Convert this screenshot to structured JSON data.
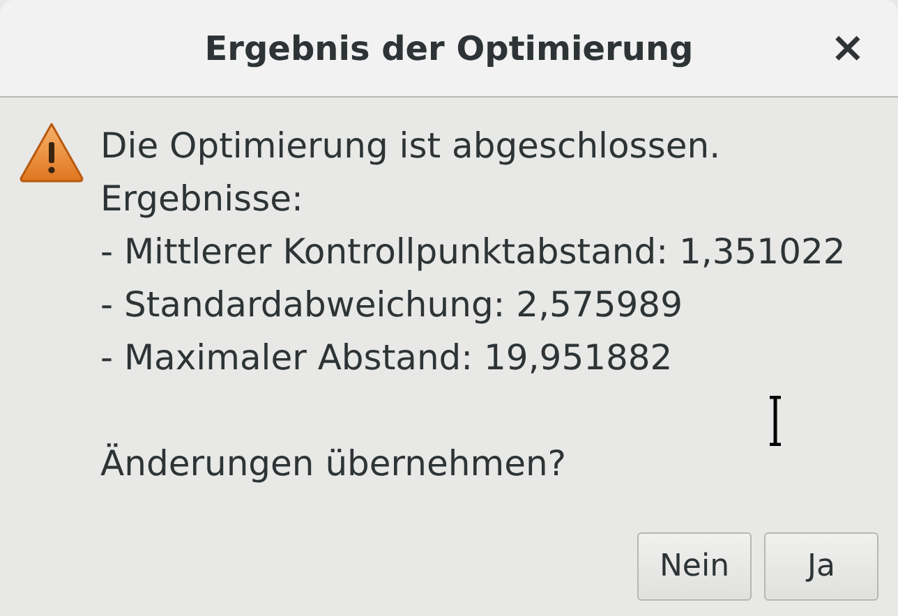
{
  "window": {
    "title": "Ergebnis der Optimierung",
    "close": "×"
  },
  "message_lines": [
    "Die Optimierung ist abgeschlossen.",
    "Ergebnisse:",
    "- Mittlerer Kontrollpunktabstand: 1,351022",
    "- Standardabweichung: 2,575989",
    "- Maximaler Abstand: 19,951882"
  ],
  "question": "Änderungen übernehmen?",
  "buttons": [
    "Nein",
    "Ja"
  ]
}
